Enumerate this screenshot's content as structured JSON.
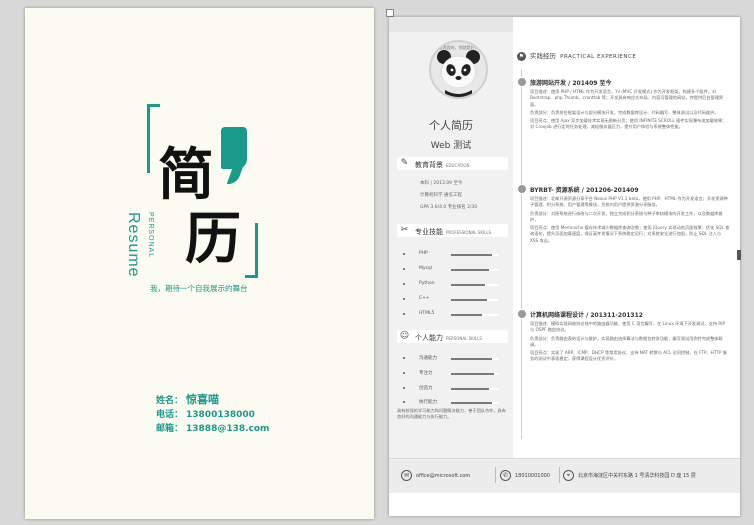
{
  "cover": {
    "char1": "简",
    "char2": "历",
    "resume_word": "Resume",
    "personal_word": "PERSONAL",
    "tagline": "我，期待一个自我展示的舞台",
    "contacts": [
      {
        "label": "姓名：",
        "value": "惊喜喵"
      },
      {
        "label": "电话：",
        "value": "13800138000"
      },
      {
        "label": "邮箱：",
        "value": "13888@138.com"
      }
    ]
  },
  "resume": {
    "avatar_caption": "看透我的，你就是好人",
    "title": "个人简历",
    "subtitle": "Web 测试",
    "education": {
      "heading": "教育背景",
      "heading_en": "EDUCATION",
      "lines": [
        "本科 | 2013.09  至今",
        "计算机科学  通信工程",
        "GPA 3.6/4.0  专业排名 2/30"
      ]
    },
    "skills": {
      "heading": "专业技能",
      "heading_en": "PROFESSIONAL SKILLS",
      "items": [
        {
          "name": "PHP",
          "level": 0.85
        },
        {
          "name": "Mysql",
          "level": 0.8
        },
        {
          "name": "Python",
          "level": 0.7
        },
        {
          "name": "C++",
          "level": 0.75
        },
        {
          "name": "HTML5",
          "level": 0.65
        }
      ]
    },
    "abilities": {
      "heading": "个人能力",
      "heading_en": "PERSONAL SKILLS",
      "items": [
        {
          "name": "沟通能力",
          "level": 0.85
        },
        {
          "name": "专注力",
          "level": 0.9
        },
        {
          "name": "创造力",
          "level": 0.8
        },
        {
          "name": "执行能力",
          "level": 0.85
        }
      ],
      "note": "具有较强的学习能力和问题解决能力，善于团队合作，具有良好的沟通能力与执行能力。"
    },
    "experience": {
      "heading": "实践经历",
      "heading_en": "PRACTICAL EXPERIENCE",
      "projects": [
        {
          "title": "旅游网站开发 / 201409 至今",
          "paras": [
            "项目描述：使用 PHP / HTML 作为开发语言，Yii (MVC 开发模式) 作为开发框架，构建多个组件，对 Bootstrap、php Thumb、cronttab 等；开发具有响应式布局、内容可管理的网站，并提供后台管理界面。",
            "负责部分：负责前台框架设计与部分模块开发，完成数据库设计、代码编写、整体测试以及代码维护。",
            "项目亮点：使用 Ajax 异步加载技术实现无刷新分页；使用 INFINITE SCROLL 插件实现瀑布流加载效果；对 Cronjob 进行定时任务处理，减轻服务器压力，提升用户体验与系统整体性能。"
          ]
        },
        {
          "title": "BYRBT- 资源系统 / 201206-201409",
          "paras": [
            "项目描述：北邮开源资源分享平台 Nexus PHP V1.1 beta，使用 PHP、HTML 作为开发语言；开发资源种子管理、积分系统、用户管理等模块，为校内用户提供资源分享服务。",
            "负责部分：对原系统进行修改与二次开发，独立完成积分系统与种子审核模块的开发工作，以及数据库维护。",
            "项目亮点：使用 Memcache 缓存技术减少数据库查询次数；使用 jQuery 实现动态页面效果；优化 SQL 查询语句，提升页面加载速度，保证高并发情况下系统稳定运行；对系统安全进行加固，防止 SQL 注入与 XSS 攻击。"
          ]
        },
        {
          "title": "计算机网络课程设计 / 201311-201312",
          "paras": [
            "项目描述：模拟实现网络协议栈中的路由器功能，使用 C 语言编写，在 Linux 环境下开发调试，支持 RIP 与 OSPF 路由协议。",
            "负责部分：负责路由表的设计与维护，实现路由选择算法与数据包转发功能，编写测试用例并完成整体联调。",
            "项目亮点：实现了 ARP、ICMP、DHCP 等常用协议，支持 NAT 转换与 ACL 访问控制，在 FTP、HTTP 服务的测试中表现稳定，获得课程设计优秀评价。"
          ]
        }
      ]
    },
    "footer": {
      "email": "office@microsoft.com",
      "phone": "18010001000",
      "address": "北京市海淀区中关村东路 1 号清华科技园 D 座 15 层"
    }
  }
}
